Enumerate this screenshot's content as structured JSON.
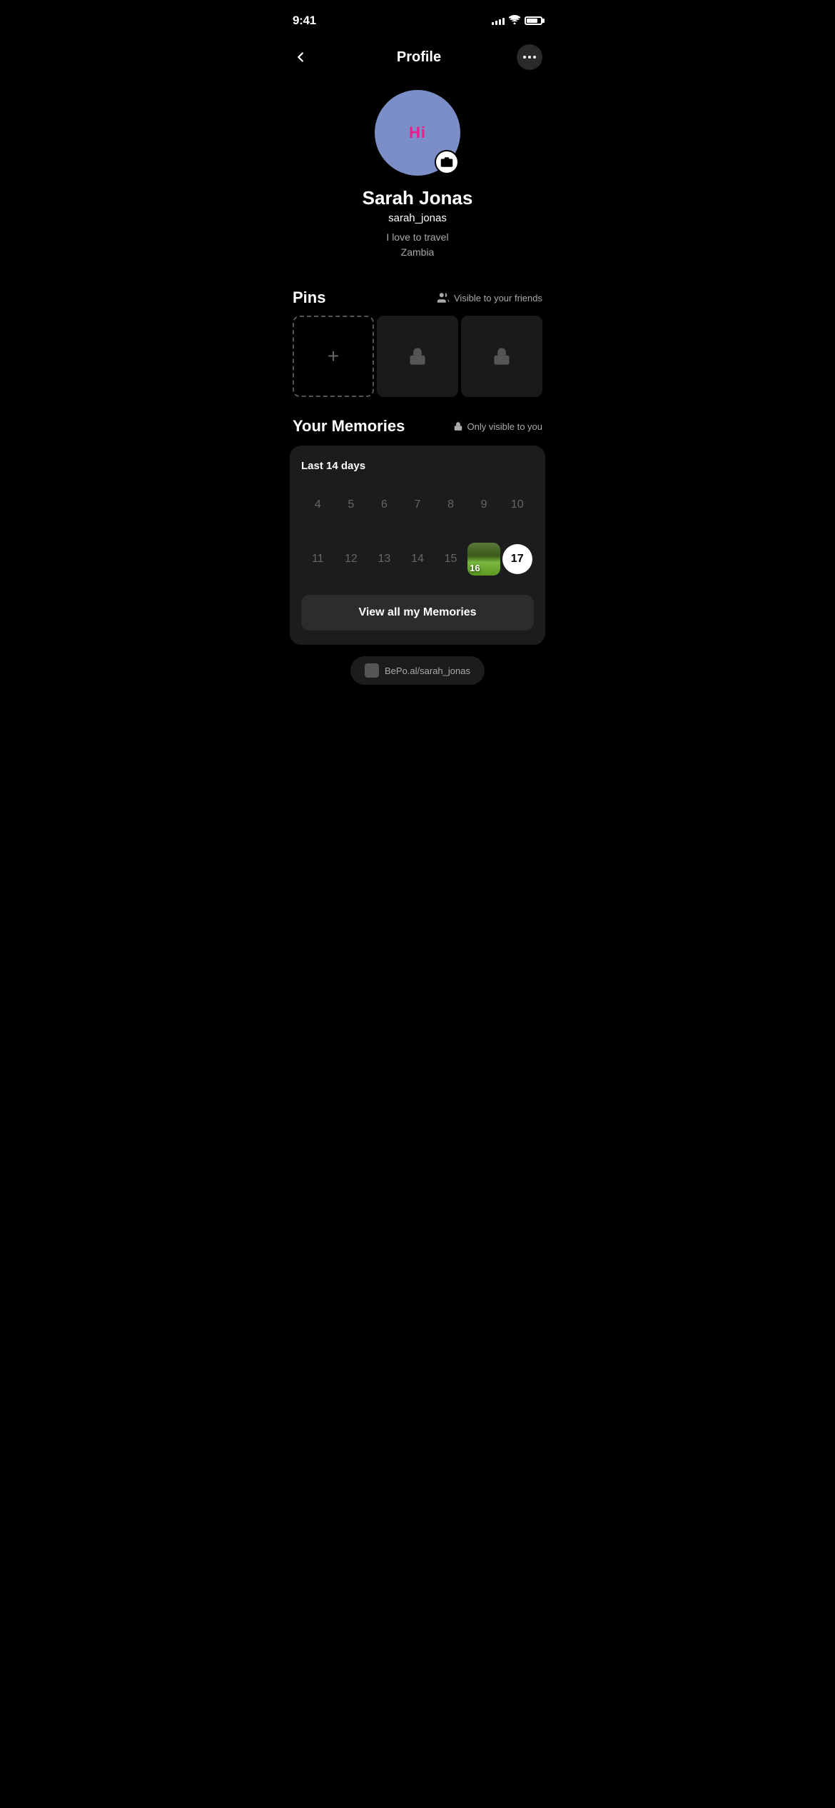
{
  "statusBar": {
    "time": "9:41",
    "signalBars": [
      3,
      5,
      7,
      9,
      11
    ],
    "battery": 80
  },
  "header": {
    "title": "Profile",
    "backLabel": "back",
    "moreLabel": "more options"
  },
  "profile": {
    "avatarText": "Hi",
    "name": "Sarah Jonas",
    "username": "sarah_jonas",
    "bio": "I love to travel",
    "location": "Zambia",
    "cameraLabel": "change photo"
  },
  "pins": {
    "sectionTitle": "Pins",
    "visibilityText": "Visible to your friends",
    "addPinLabel": "add pin",
    "lockedPin1Label": "locked pin",
    "lockedPin2Label": "locked pin"
  },
  "memories": {
    "sectionTitle": "Your Memories",
    "visibilityText": "Only visible to you",
    "subtitleText": "Last 14 days",
    "calendarRow1": [
      "4",
      "5",
      "6",
      "7",
      "8",
      "9",
      "10"
    ],
    "calendarRow2": [
      "11",
      "12",
      "13",
      "14",
      "15",
      "16",
      "17"
    ],
    "memoryDay": "16",
    "todayDay": "17",
    "viewAllLabel": "View all my Memories"
  },
  "bottomHint": {
    "text": "BePo.al/sarah_jonas"
  }
}
